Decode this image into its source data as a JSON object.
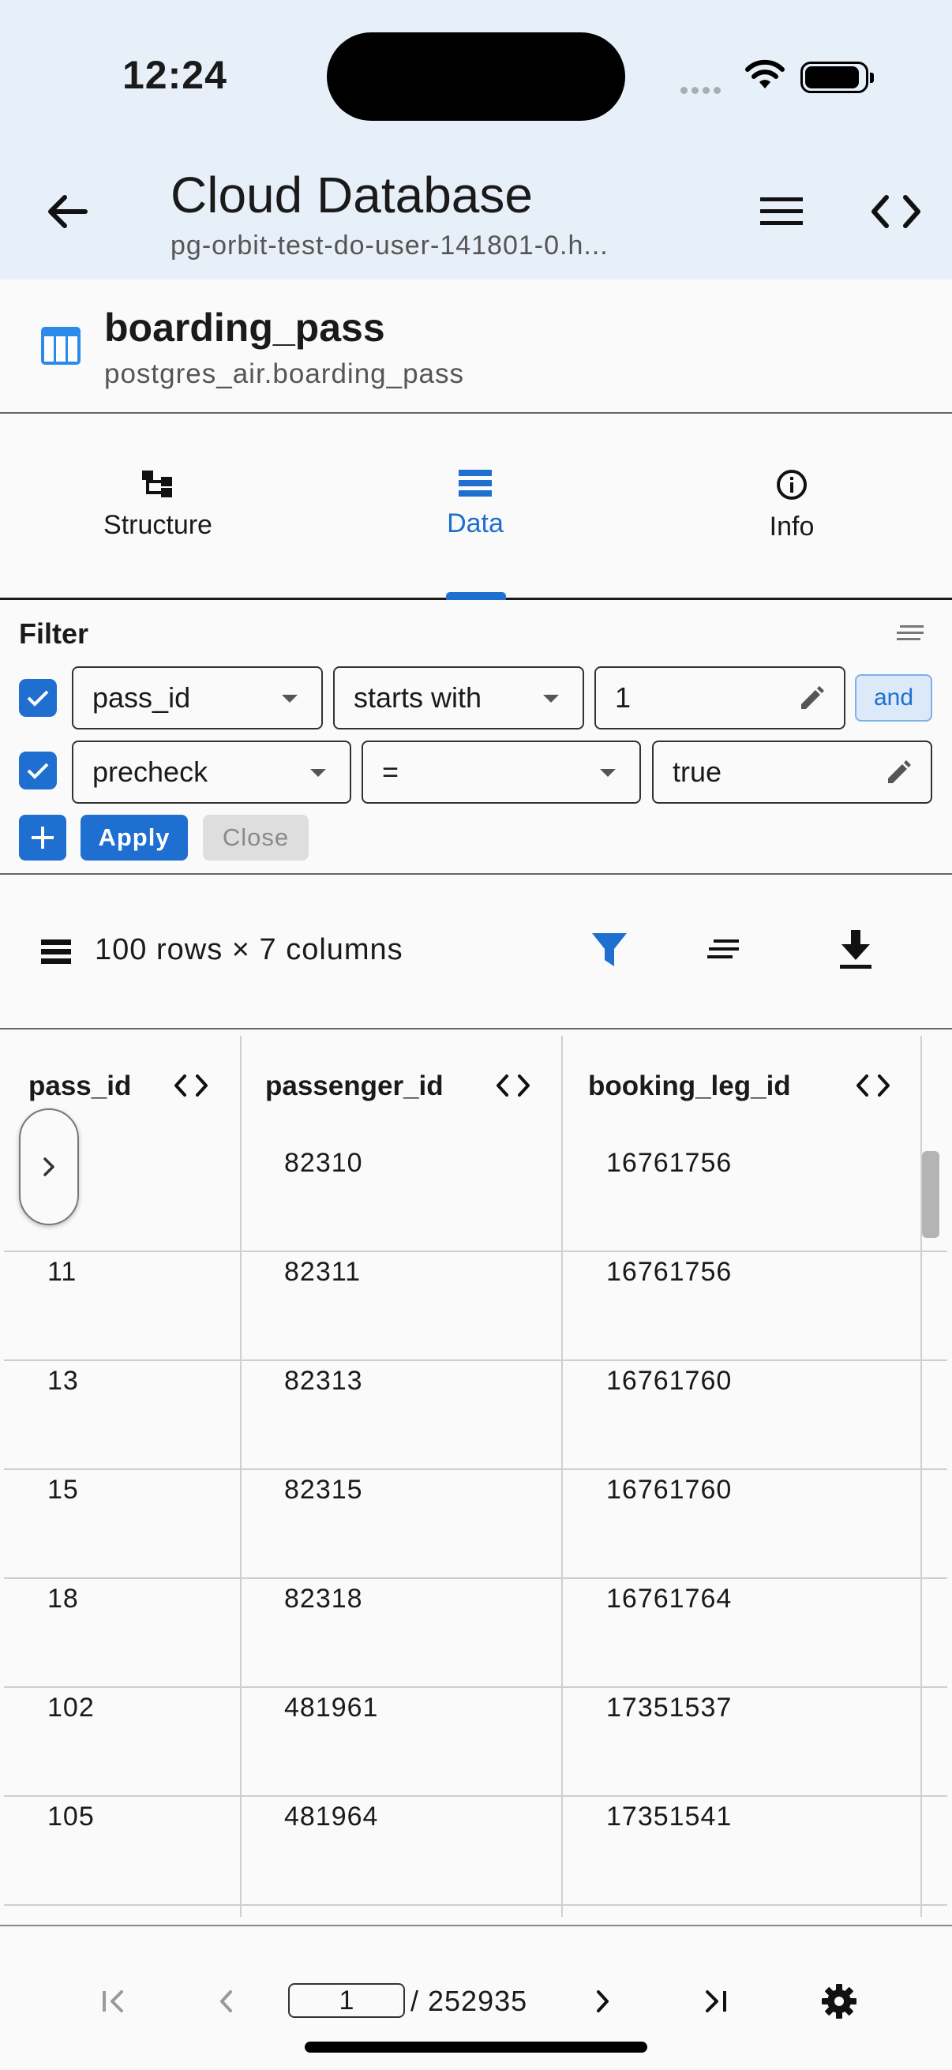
{
  "status_bar": {
    "time": "12:24"
  },
  "app_bar": {
    "title": "Cloud Database",
    "subtitle": "pg-orbit-test-do-user-141801-0.h..."
  },
  "table": {
    "name": "boarding_pass",
    "schema_name": "postgres_air.boarding_pass"
  },
  "tabs": [
    {
      "label": "Structure",
      "icon": "structure-icon",
      "active": false
    },
    {
      "label": "Data",
      "icon": "data-icon",
      "active": true
    },
    {
      "label": "Info",
      "icon": "info-icon",
      "active": false
    }
  ],
  "filter": {
    "title": "Filter",
    "conditions": [
      {
        "checked": true,
        "column": "pass_id",
        "operator": "starts with",
        "value": "1",
        "conjunction": "and"
      },
      {
        "checked": true,
        "column": "precheck",
        "operator": "=",
        "value": "true"
      }
    ],
    "apply_label": "Apply",
    "close_label": "Close"
  },
  "toolbar": {
    "rows_summary": "100 rows × 7 columns"
  },
  "grid": {
    "columns": [
      "pass_id",
      "passenger_id",
      "booking_leg_id"
    ],
    "rows": [
      [
        "",
        "82310",
        "16761756"
      ],
      [
        "11",
        "82311",
        "16761756"
      ],
      [
        "13",
        "82313",
        "16761760"
      ],
      [
        "15",
        "82315",
        "16761760"
      ],
      [
        "18",
        "82318",
        "16761764"
      ],
      [
        "102",
        "481961",
        "17351537"
      ],
      [
        "105",
        "481964",
        "17351541"
      ]
    ]
  },
  "pagination": {
    "current_page": "1",
    "total_pages": "/ 252935"
  },
  "colors": {
    "accent": "#1e6fcf",
    "app_bar_bg": "#e7eff8",
    "page_bg": "#fafafa"
  }
}
